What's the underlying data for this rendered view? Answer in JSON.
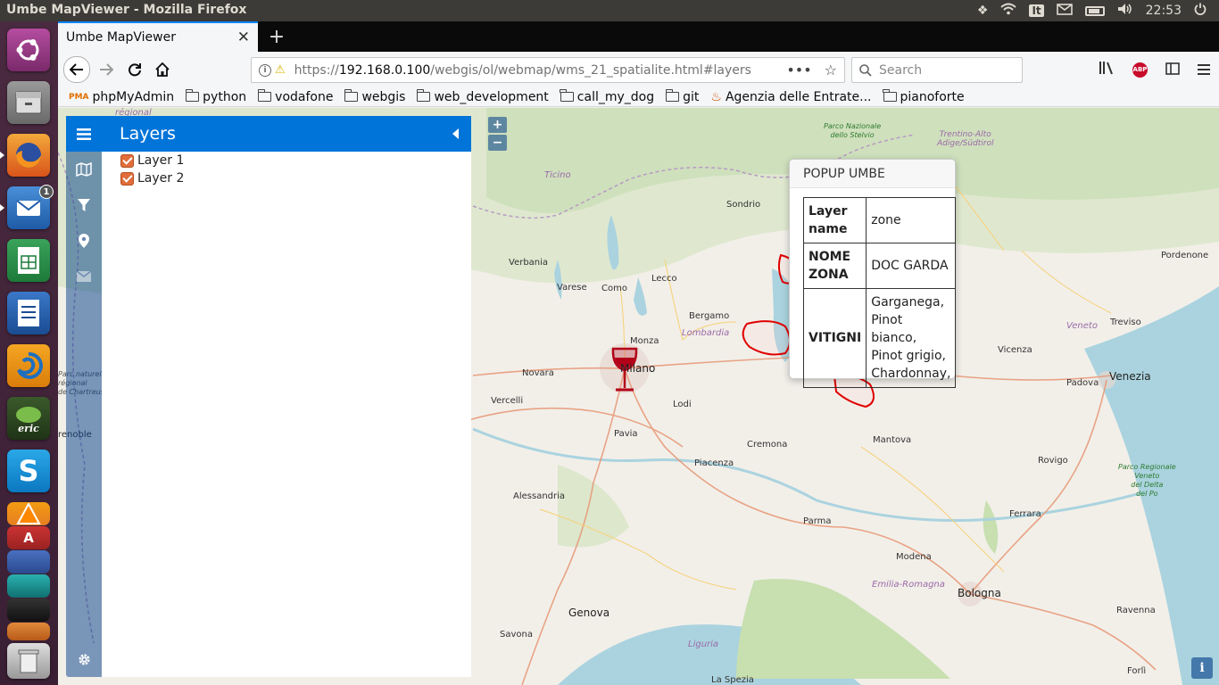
{
  "window": {
    "title": "Umbe MapViewer - Mozilla Firefox"
  },
  "system_tray": {
    "keyboard": "It",
    "clock": "22:53"
  },
  "launcher": {
    "thunderbird_badge": "1"
  },
  "browser": {
    "tab_title": "Umbe MapViewer",
    "url_prefix": "https://",
    "url_domain": "192.168.0.100",
    "url_path": "/webgis/ol/webmap/wms_21_spatialite.html#layers",
    "search_placeholder": "Search",
    "bookmarks": [
      {
        "label": "phpMyAdmin",
        "icon": "pma-icon"
      },
      {
        "label": "python",
        "icon": "folder-icon"
      },
      {
        "label": "vodafone",
        "icon": "folder-icon"
      },
      {
        "label": "webgis",
        "icon": "folder-icon"
      },
      {
        "label": "web_development",
        "icon": "folder-icon"
      },
      {
        "label": "call_my_dog",
        "icon": "folder-icon"
      },
      {
        "label": "git",
        "icon": "folder-icon"
      },
      {
        "label": "Agenzia delle Entrate...",
        "icon": "agenzia-icon"
      },
      {
        "label": "pianoforte",
        "icon": "folder-icon"
      }
    ]
  },
  "sidebar": {
    "header": "Layers",
    "layers": [
      {
        "label": "Layer 1",
        "checked": true
      },
      {
        "label": "Layer 2",
        "checked": true
      }
    ]
  },
  "map": {
    "zoom_in": "+",
    "zoom_out": "−",
    "attribution": "i",
    "labels": {
      "milano": "Milano",
      "varese": "Varese",
      "como": "Como",
      "lecco": "Lecco",
      "bergamo": "Bergamo",
      "monza": "Monza",
      "novara": "Novara",
      "vercelli": "Vercelli",
      "lodi": "Lodi",
      "pavia": "Pavia",
      "cremona": "Cremona",
      "piacenza": "Piacenza",
      "alessandria": "Alessandria",
      "parma": "Parma",
      "mantova": "Mantova",
      "modena": "Modena",
      "bologna": "Bologna",
      "genova": "Genova",
      "savona": "Savona",
      "ferrara": "Ferrara",
      "rovigo": "Rovigo",
      "padova": "Padova",
      "venezia": "Venezia",
      "vicenza": "Vicenza",
      "treviso": "Treviso",
      "pordenone": "Pordenone",
      "ravenna": "Ravenna",
      "forli": "Forlì",
      "sondrio": "Sondrio",
      "verbania": "Verbania",
      "grenoble": "renoble",
      "la_spezia": "La Spezia",
      "lombardia": "Lombardia",
      "veneto": "Veneto",
      "ticino": "Ticino",
      "emilia_romagna": "Emilia-Romagna",
      "liguria": "Liguria",
      "regional": "régional",
      "parco_stelvio": "Parco Nazionale\ndello Stelvio",
      "trentino": "Trentino-Alto\nAdige/Südtirol",
      "parco_delta": "Parco Regionale\nVeneto\ndel Delta\ndel Po",
      "parc_chartreuse": "Parc naturel\nrégional\nde Chartreuse"
    }
  },
  "popup": {
    "title": "POPUP UMBE",
    "rows": [
      {
        "key": "Layer name",
        "value": "zone"
      },
      {
        "key": "NOME ZONA",
        "value": "DOC GARDA"
      },
      {
        "key": "VITIGNI",
        "value": "Garganega, Pinot bianco, Pinot grigio, Chardonnay,"
      }
    ]
  },
  "colors": {
    "accent": "#0074d9",
    "checkbox": "#e06d3a",
    "zone_outline": "#e00000",
    "wine_icon": "#b30018"
  }
}
